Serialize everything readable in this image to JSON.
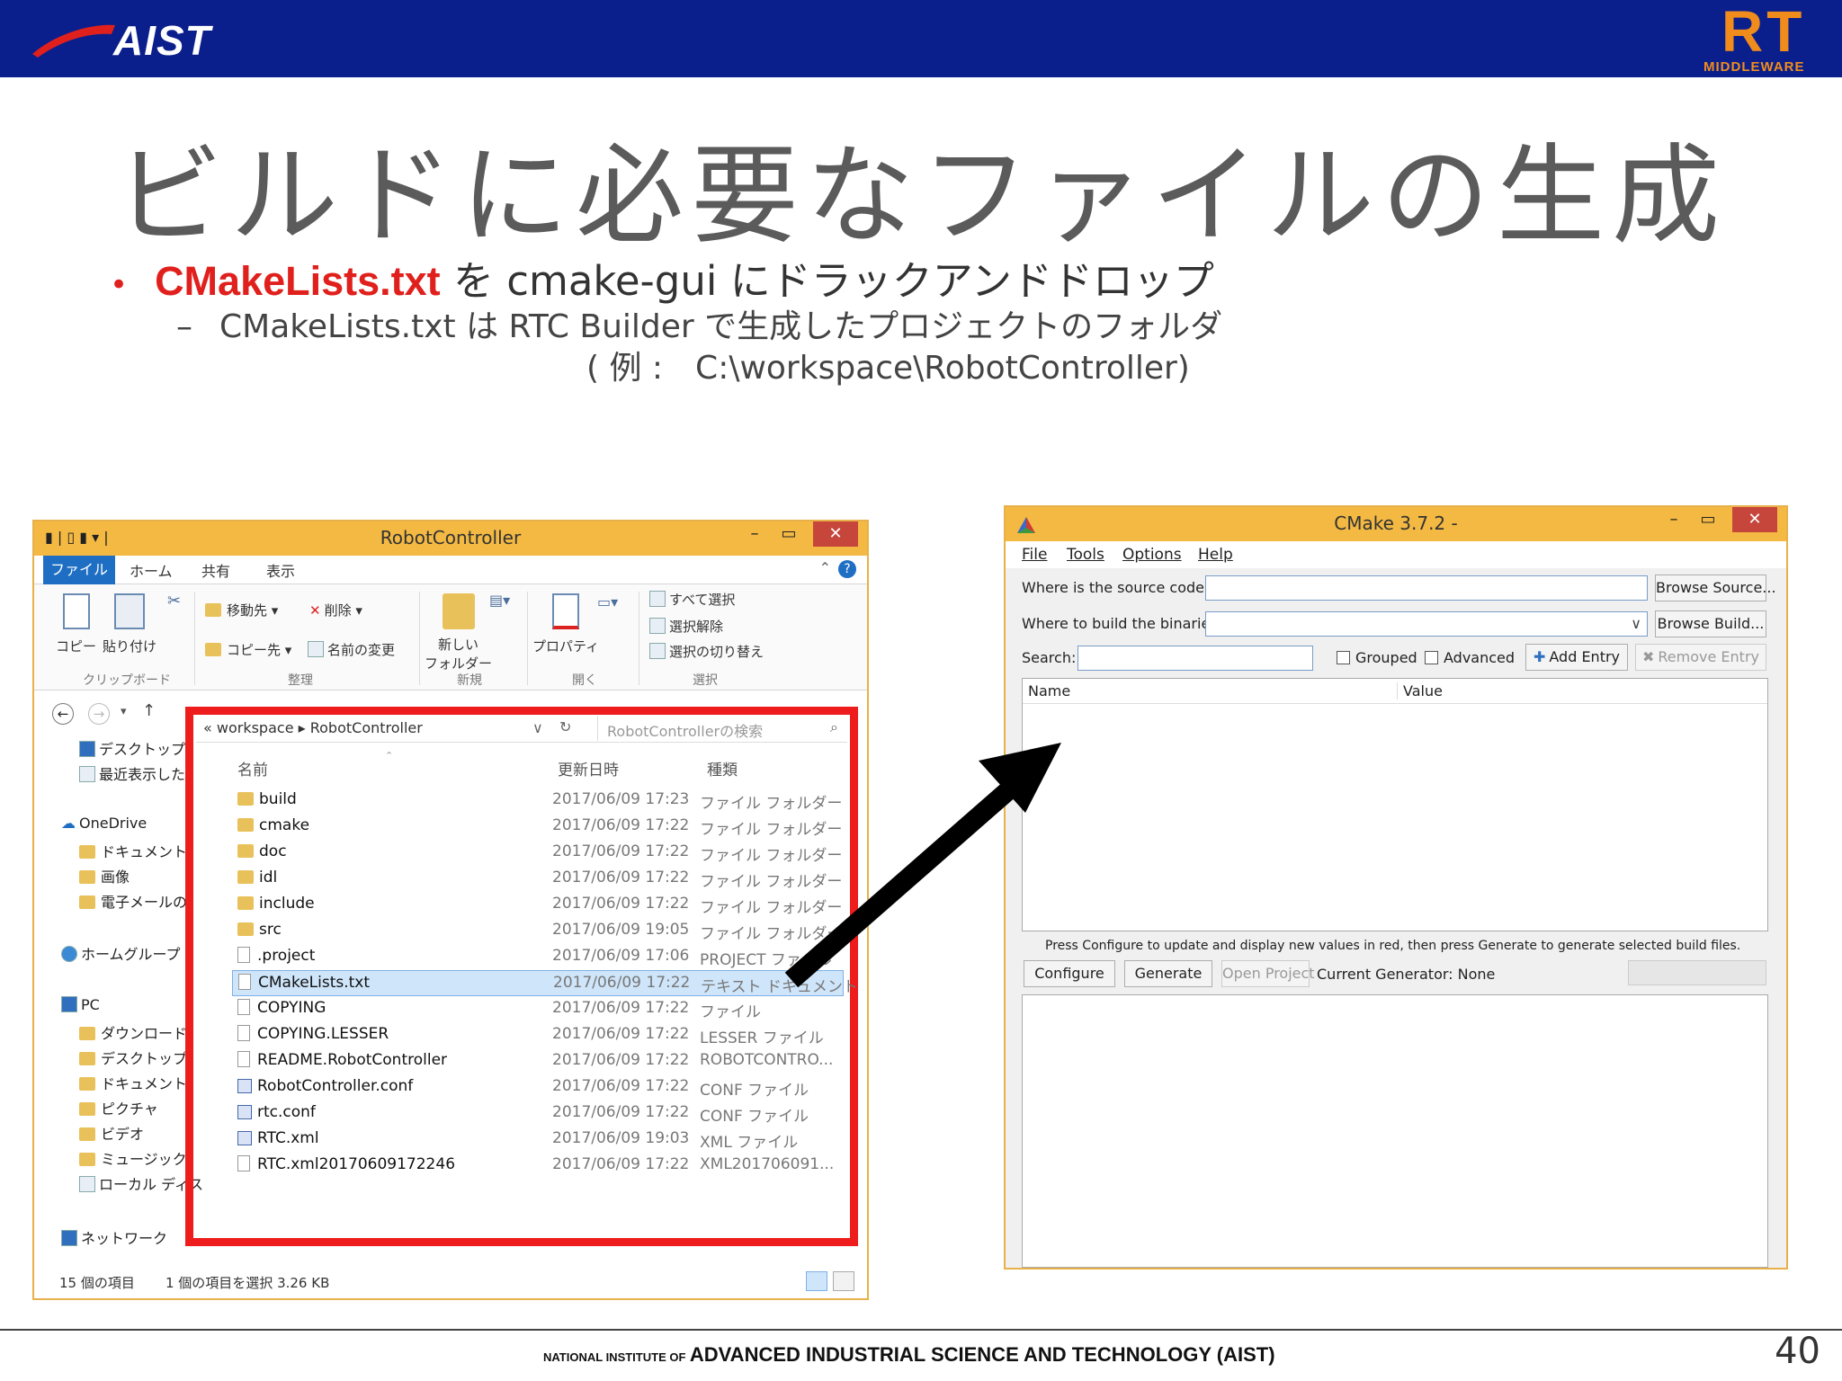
{
  "header": {
    "org_logo": "AIST",
    "rt_logo_mark": "RT",
    "rt_logo_sub": "MIDDLEWARE"
  },
  "title": "ビルドに必要なファイルの生成",
  "bullets": {
    "b1_red": "CMakeLists.txt",
    "b1_rest": " を cmake-gui にドラックアンドドロップ",
    "b2": "CMakeLists.txt は RTC Builder で生成したプロジェクトのフォルダ",
    "b3": "( 例 :　C:\\workspace\\RobotController)"
  },
  "explorer": {
    "title": "RobotController",
    "tabs": [
      "ファイル",
      "ホーム",
      "共有",
      "表示"
    ],
    "ribbon": {
      "copy": "コピー",
      "paste": "貼り付け",
      "move_to": "移動先 ▾",
      "copy_to": "コピー先 ▾",
      "delete": "削除 ▾",
      "rename": "名前の変更",
      "new_folder_1": "新しい",
      "new_folder_2": "フォルダー",
      "properties": "プロパティ",
      "select_all": "すべて選択",
      "select_none": "選択解除",
      "invert_selection": "選択の切り替え",
      "groups": [
        "クリップボード",
        "整理",
        "新規",
        "開く",
        "選択"
      ]
    },
    "address": {
      "crumb1": "workspace",
      "crumb2": "RobotController",
      "search_placeholder": "RobotControllerの検索"
    },
    "columns": {
      "name": "名前",
      "date": "更新日時",
      "type": "種類"
    },
    "nav": [
      "デスクトップ",
      "最近表示した",
      "OneDrive",
      "ドキュメント",
      "画像",
      "電子メールの",
      "ホームグループ",
      "PC",
      "ダウンロード",
      "デスクトップ",
      "ドキュメント",
      "ピクチャ",
      "ビデオ",
      "ミュージック",
      "ローカル ディス",
      "ネットワーク"
    ],
    "files": [
      {
        "name": "build",
        "date": "2017/06/09 17:23",
        "type": "ファイル フォルダー",
        "kind": "folder"
      },
      {
        "name": "cmake",
        "date": "2017/06/09 17:22",
        "type": "ファイル フォルダー",
        "kind": "folder"
      },
      {
        "name": "doc",
        "date": "2017/06/09 17:22",
        "type": "ファイル フォルダー",
        "kind": "folder"
      },
      {
        "name": "idl",
        "date": "2017/06/09 17:22",
        "type": "ファイル フォルダー",
        "kind": "folder"
      },
      {
        "name": "include",
        "date": "2017/06/09 17:22",
        "type": "ファイル フォルダー",
        "kind": "folder"
      },
      {
        "name": "src",
        "date": "2017/06/09 19:05",
        "type": "ファイル フォルダー",
        "kind": "folder"
      },
      {
        "name": ".project",
        "date": "2017/06/09 17:06",
        "type": "PROJECT ファイル",
        "kind": "doc"
      },
      {
        "name": "CMakeLists.txt",
        "date": "2017/06/09 17:22",
        "type": "テキスト ドキュメント",
        "kind": "doc"
      },
      {
        "name": "COPYING",
        "date": "2017/06/09 17:22",
        "type": "ファイル",
        "kind": "doc"
      },
      {
        "name": "COPYING.LESSER",
        "date": "2017/06/09 17:22",
        "type": "LESSER ファイル",
        "kind": "doc"
      },
      {
        "name": "README.RobotController",
        "date": "2017/06/09 17:22",
        "type": "ROBOTCONTRO...",
        "kind": "doc"
      },
      {
        "name": "RobotController.conf",
        "date": "2017/06/09 17:22",
        "type": "CONF ファイル",
        "kind": "cfg"
      },
      {
        "name": "rtc.conf",
        "date": "2017/06/09 17:22",
        "type": "CONF ファイル",
        "kind": "cfg"
      },
      {
        "name": "RTC.xml",
        "date": "2017/06/09 19:03",
        "type": "XML ファイル",
        "kind": "cfg"
      },
      {
        "name": "RTC.xml20170609172246",
        "date": "2017/06/09 17:22",
        "type": "XML201706091...",
        "kind": "doc"
      }
    ],
    "selected_index": 7,
    "status_count": "15 個の項目",
    "status_selected": "1 個の項目を選択  3.26 KB"
  },
  "cmake": {
    "title": "CMake 3.7.2 -",
    "menu": [
      "File",
      "Tools",
      "Options",
      "Help"
    ],
    "source_label": "Where is the source code:",
    "build_label": "Where to build the binaries:",
    "browse_source": "Browse Source...",
    "browse_build": "Browse Build...",
    "search_label": "Search:",
    "grouped": "Grouped",
    "advanced": "Advanced",
    "add_entry": "Add Entry",
    "remove_entry": "Remove Entry",
    "col_name": "Name",
    "col_value": "Value",
    "hint": "Press Configure to update and display new values in red, then press Generate to generate selected build files.",
    "configure": "Configure",
    "generate": "Generate",
    "open_project": "Open Project",
    "current_generator": "Current Generator: None"
  },
  "footer": {
    "small_text": "NATIONAL INSTITUTE OF",
    "big_text": "ADVANCED INDUSTRIAL SCIENCE AND TECHNOLOGY (AIST)",
    "page_number": "40"
  },
  "colors": {
    "banner": "#0b1f8c",
    "accent_red": "#e0201c",
    "window_frame": "#f3b943",
    "rt_orange": "#f08c1c"
  }
}
